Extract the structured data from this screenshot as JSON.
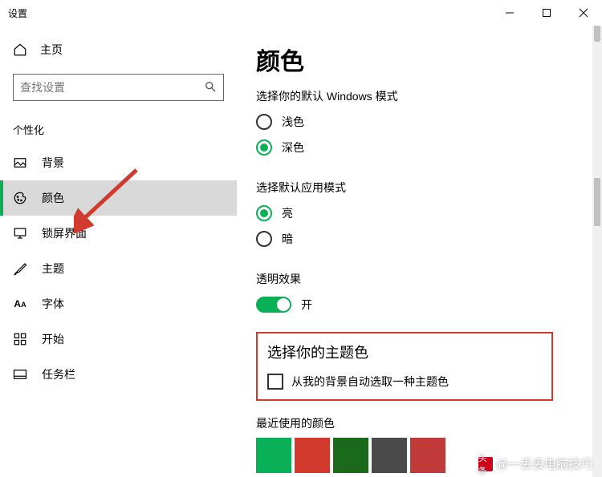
{
  "window": {
    "title": "设置"
  },
  "sidebar": {
    "home": "主页",
    "search_placeholder": "查找设置",
    "section": "个性化",
    "items": [
      {
        "label": "背景"
      },
      {
        "label": "颜色"
      },
      {
        "label": "锁屏界面"
      },
      {
        "label": "主题"
      },
      {
        "label": "字体"
      },
      {
        "label": "开始"
      },
      {
        "label": "任务栏"
      }
    ]
  },
  "content": {
    "title": "颜色",
    "windows_mode": {
      "heading": "选择你的默认 Windows 模式",
      "light": "浅色",
      "dark": "深色",
      "selected": "dark"
    },
    "app_mode": {
      "heading": "选择默认应用模式",
      "light": "亮",
      "dark": "暗",
      "selected": "light"
    },
    "transparency": {
      "heading": "透明效果",
      "state_label": "开"
    },
    "accent": {
      "heading": "选择你的主题色",
      "auto_label": "从我的背景自动选取一种主题色"
    },
    "recent": {
      "heading": "最近使用的颜色",
      "colors": [
        "#0ab055",
        "#d23a2e",
        "#1b6a1b",
        "#4a4a4a",
        "#c13a3a"
      ]
    }
  },
  "watermark": {
    "brand": "头条",
    "text": "@一丢丢电脑技巧"
  }
}
